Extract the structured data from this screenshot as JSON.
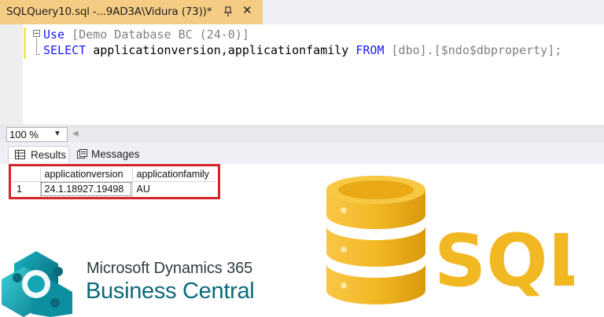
{
  "tab": {
    "title": "SQLQuery10.sql -...9AD3A\\Vidura (73))*",
    "close": "✕"
  },
  "editor": {
    "line1": {
      "keyword": "Use",
      "rest": " [Demo Database BC (24-0)]"
    },
    "line2": {
      "keyword_select": "SELECT",
      "columns": " applicationversion,applicationfamily ",
      "keyword_from": "FROM",
      "table_a": " [dbo]",
      "dot": ".",
      "table_b": "[$ndo$dbproperty]",
      "end": ";"
    }
  },
  "zoom": {
    "value": "100 %"
  },
  "results_tabs": [
    {
      "label": "Results"
    },
    {
      "label": "Messages"
    }
  ],
  "grid": {
    "columns": [
      "applicationversion",
      "applicationfamily"
    ],
    "rows": [
      {
        "num": "1",
        "applicationversion": "24.1.18927.19498",
        "applicationfamily": "AU"
      }
    ]
  },
  "branding": {
    "bc_title": "Microsoft Dynamics 365",
    "bc_subtitle": "Business Central",
    "sql_text": "SQL"
  },
  "colors": {
    "tab_active": "#f5cc84",
    "highlight_border": "#d6242c",
    "sql_gold": "#f2b824",
    "bc_teal": "#0b6a7a"
  }
}
